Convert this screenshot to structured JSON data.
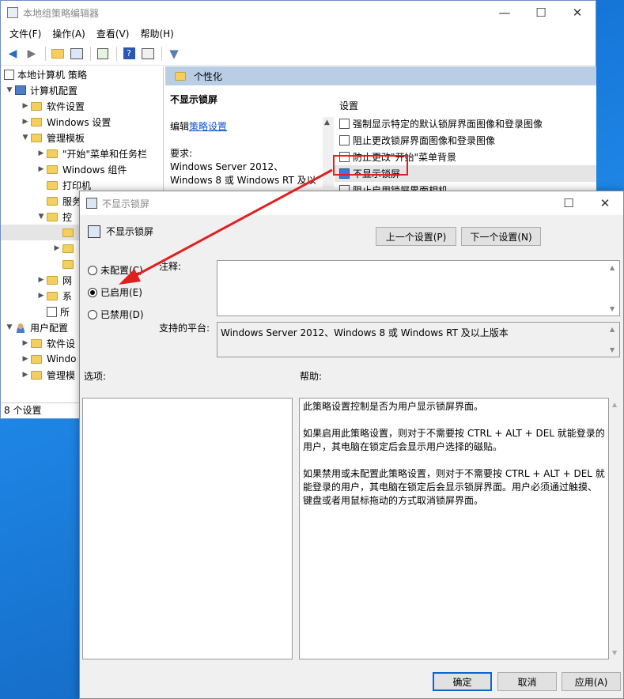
{
  "main_window": {
    "title": "本地组策略编辑器",
    "menu": [
      "文件(F)",
      "操作(A)",
      "查看(V)",
      "帮助(H)"
    ],
    "controls": {
      "minimize": "—",
      "maximize": "☐",
      "close": "✕"
    },
    "tree": {
      "root": "本地计算机 策略",
      "computer_config": "计算机配置",
      "software_settings": "软件设置",
      "windows_settings": "Windows 设置",
      "admin_templates": "管理模板",
      "start_menu": "\"开始\"菜单和任务栏",
      "windows_components": "Windows 组件",
      "printers": "打印机",
      "server_partial": "服务",
      "control_partial": "控",
      "network_partial": "网",
      "system_partial": "系",
      "all_partial": "所",
      "user_config": "用户配置",
      "user_software": "软件设",
      "user_windows": "Windo",
      "user_admin": "管理模"
    },
    "right_header": "个性化",
    "description": {
      "title": "不显示锁屏",
      "edit_prefix": "编辑",
      "edit_link": "策略设置",
      "requirement_label": "要求:",
      "requirement_line1": "Windows Server 2012、",
      "requirement_line2": "Windows 8 或 Windows RT 及以"
    },
    "settings_header": "设置",
    "settings": [
      "强制显示特定的默认锁屏界面图像和登录图像",
      "阻止更改锁屏界面图像和登录图像",
      "防止更改\"开始\"菜单背景",
      "不显示锁屏",
      "阻止启用锁屏界面相机"
    ],
    "status": "8 个设置"
  },
  "dialog": {
    "title": "不显示锁屏",
    "header": "不显示锁屏",
    "prev_button": "上一个设置(P)",
    "next_button": "下一个设置(N)",
    "radio_not_configured": "未配置(C)",
    "radio_enabled": "已启用(E)",
    "radio_disabled": "已禁用(D)",
    "selected_option": "已启用(E)",
    "comment_label": "注释:",
    "platform_label": "支持的平台:",
    "platform_value": "Windows Server 2012、Windows 8 或 Windows RT 及以上版本",
    "options_label": "选项:",
    "help_label": "帮助:",
    "help_paragraphs": [
      "此策略设置控制是否为用户显示锁屏界面。",
      "如果启用此策略设置，则对于不需要按 CTRL + ALT + DEL 就能登录的用户，其电脑在锁定后会显示用户选择的磁贴。",
      "如果禁用或未配置此策略设置，则对于不需要按 CTRL + ALT + DEL 就能登录的用户，其电脑在锁定后会显示锁屏界面。用户必须通过触摸、键盘或者用鼠标拖动的方式取消锁屏界面。"
    ],
    "ok_button": "确定",
    "cancel_button": "取消",
    "apply_button": "应用(A)"
  },
  "colors": {
    "highlight_box": "#e02020",
    "arrow": "#e02020",
    "desktop": "#1f86e6"
  }
}
